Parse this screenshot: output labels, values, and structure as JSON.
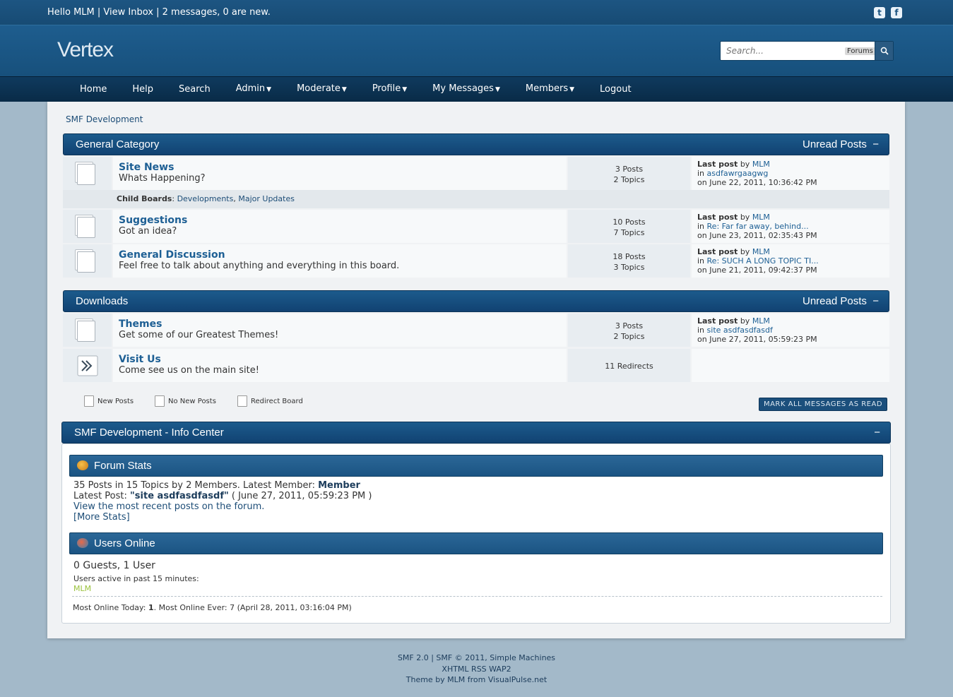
{
  "topbar": {
    "greeting": "Hello MLM",
    "inbox_link": "View Inbox",
    "messages": "2 messages, 0 are new.",
    "social": [
      {
        "icon": "twitter-icon",
        "glyph": "t"
      },
      {
        "icon": "facebook-icon",
        "glyph": "f"
      }
    ]
  },
  "header": {
    "logo": "Vertex",
    "search_placeholder": "Search...",
    "search_scope": "Forums"
  },
  "nav": [
    {
      "label": "Home",
      "dropdown": false
    },
    {
      "label": "Help",
      "dropdown": false
    },
    {
      "label": "Search",
      "dropdown": false
    },
    {
      "label": "Admin",
      "dropdown": true
    },
    {
      "label": "Moderate",
      "dropdown": true
    },
    {
      "label": "Profile",
      "dropdown": true
    },
    {
      "label": "My Messages",
      "dropdown": true
    },
    {
      "label": "Members",
      "dropdown": true
    },
    {
      "label": "Logout",
      "dropdown": false
    }
  ],
  "breadcrumb": "SMF Development",
  "categories": [
    {
      "title": "General Category",
      "unread": "Unread Posts",
      "collapse": "−",
      "boards": [
        {
          "name": "Site News",
          "desc": "Whats Happening?",
          "posts": "3 Posts",
          "topics": "2 Topics",
          "last_label": "Last post",
          "by": "by",
          "user": "MLM",
          "in": "in",
          "topic": "asdfawrgaagwg",
          "on": "on June 22, 2011, 10:36:42 PM"
        },
        {
          "name": "Suggestions",
          "desc": "Got an idea?",
          "posts": "10 Posts",
          "topics": "7 Topics",
          "last_label": "Last post",
          "by": "by",
          "user": "MLM",
          "in": "in",
          "topic": "Re: Far far away, behind...",
          "on": "on June 23, 2011, 02:35:43 PM"
        },
        {
          "name": "General Discussion",
          "desc": "Feel free to talk about anything and everything in this board.",
          "posts": "18 Posts",
          "topics": "3 Topics",
          "last_label": "Last post",
          "by": "by",
          "user": "MLM",
          "in": "in",
          "topic": "Re: SUCH A LONG TOPIC TI...",
          "on": "on June 21, 2011, 09:42:37 PM"
        }
      ],
      "child_boards": {
        "label": "Child Boards",
        "items": [
          "Developments",
          "Major Updates"
        ]
      }
    },
    {
      "title": "Downloads",
      "unread": "Unread Posts",
      "collapse": "−",
      "boards": [
        {
          "name": "Themes",
          "desc": "Get some of our Greatest Themes!",
          "posts": "3 Posts",
          "topics": "2 Topics",
          "last_label": "Last post",
          "by": "by",
          "user": "MLM",
          "in": "in",
          "topic": "site asdfasdfasdf",
          "on": "on June 27, 2011, 05:59:23 PM"
        },
        {
          "name": "Visit Us",
          "desc": "Come see us on the main site!",
          "redirects": "11 Redirects"
        }
      ]
    }
  ],
  "legend": {
    "new_posts": "New Posts",
    "no_new_posts": "No New Posts",
    "redirect": "Redirect Board"
  },
  "mark_read": "MARK ALL MESSAGES AS READ",
  "info_center": {
    "title": "SMF Development - Info Center",
    "collapse": "−",
    "stats_title": "Forum Stats",
    "stats_line1": "35 Posts in 15 Topics by 2 Members. Latest Member:",
    "latest_member": "Member",
    "latest_post_label": "Latest Post:",
    "latest_post": "\"site asdfasdfasdf\"",
    "latest_post_date": "( June 27, 2011, 05:59:23 PM )",
    "recent_link": "View the most recent posts on the forum.",
    "more_stats": "[More Stats]",
    "users_title": "Users Online",
    "users_count": "0 Guests, 1 User",
    "active_label": "Users active in past 15 minutes:",
    "active_user": "MLM",
    "most_online_label": "Most Online Today:",
    "most_online_today": "1",
    "most_online_ever": ". Most Online Ever: 7 (April 28, 2011, 03:16:04 PM)"
  },
  "footer": {
    "line1": "SMF 2.0 | SMF © 2011, Simple Machines",
    "line2": "XHTML  RSS  WAP2",
    "line3": "Theme by MLM from VisualPulse.net"
  }
}
